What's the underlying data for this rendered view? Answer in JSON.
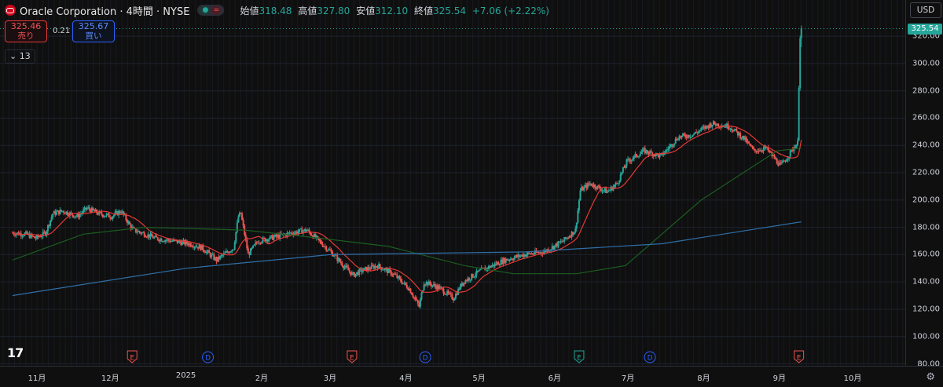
{
  "legend": {
    "symbol": "Oracle Corporation · 4時間 · NYSE",
    "ohlc": [
      {
        "label": "始値",
        "value": "318.48"
      },
      {
        "label": "高値",
        "value": "327.80"
      },
      {
        "label": "安値",
        "value": "312.10"
      },
      {
        "label": "終値",
        "value": "325.54"
      }
    ],
    "change": "+7.06 (+2.22%)"
  },
  "trade": {
    "sell_price": "325.46",
    "sell_label": "売り",
    "buy_price": "325.67",
    "buy_label": "買い",
    "spread": "0.21"
  },
  "indicator_toggle": "13",
  "currency": "USD",
  "last_price": "325.54",
  "colors": {
    "up": "#26a69a",
    "down": "#ef5350",
    "ma_fast": "#e53935",
    "ma_mid": "#1b5e20",
    "ma_slow": "#2f6fa8",
    "grid": "#1e222d"
  },
  "chart_data": {
    "type": "candlestick",
    "title": "",
    "xlabel": "",
    "ylabel": "",
    "ylim": [
      80,
      340
    ],
    "y_ticks": [
      "320.00",
      "300.00",
      "280.00",
      "260.00",
      "240.00",
      "220.00",
      "200.00",
      "180.00",
      "160.00",
      "140.00",
      "120.00",
      "100.00",
      "80.00"
    ],
    "x_ticks": [
      "11月",
      "12月",
      "2025",
      "2月",
      "3月",
      "4月",
      "5月",
      "6月",
      "7月",
      "8月",
      "9月",
      "10月"
    ],
    "price_path": [
      [
        "2024-10-22",
        176
      ],
      [
        "2024-10-28",
        175
      ],
      [
        "2024-11-01",
        172
      ],
      [
        "2024-11-05",
        176
      ],
      [
        "2024-11-08",
        190
      ],
      [
        "2024-11-12",
        192
      ],
      [
        "2024-11-18",
        188
      ],
      [
        "2024-11-22",
        194
      ],
      [
        "2024-11-27",
        190
      ],
      [
        "2024-12-02",
        188
      ],
      [
        "2024-12-06",
        192
      ],
      [
        "2024-12-09",
        183
      ],
      [
        "2024-12-11",
        178
      ],
      [
        "2024-12-16",
        175
      ],
      [
        "2024-12-20",
        172
      ],
      [
        "2024-12-27",
        170
      ],
      [
        "2025-01-03",
        168
      ],
      [
        "2025-01-08",
        165
      ],
      [
        "2025-01-14",
        156
      ],
      [
        "2025-01-17",
        160
      ],
      [
        "2025-01-21",
        165
      ],
      [
        "2025-01-23",
        188
      ],
      [
        "2025-01-24",
        190
      ],
      [
        "2025-01-27",
        160
      ],
      [
        "2025-01-31",
        170
      ],
      [
        "2025-02-07",
        173
      ],
      [
        "2025-02-14",
        176
      ],
      [
        "2025-02-20",
        178
      ],
      [
        "2025-02-25",
        170
      ],
      [
        "2025-03-03",
        160
      ],
      [
        "2025-03-07",
        152
      ],
      [
        "2025-03-11",
        145
      ],
      [
        "2025-03-14",
        148
      ],
      [
        "2025-03-21",
        152
      ],
      [
        "2025-03-28",
        145
      ],
      [
        "2025-04-03",
        135
      ],
      [
        "2025-04-07",
        122
      ],
      [
        "2025-04-09",
        140
      ],
      [
        "2025-04-15",
        136
      ],
      [
        "2025-04-21",
        128
      ],
      [
        "2025-04-25",
        140
      ],
      [
        "2025-05-02",
        148
      ],
      [
        "2025-05-12",
        156
      ],
      [
        "2025-05-20",
        160
      ],
      [
        "2025-05-28",
        162
      ],
      [
        "2025-06-05",
        170
      ],
      [
        "2025-06-10",
        178
      ],
      [
        "2025-06-12",
        207
      ],
      [
        "2025-06-16",
        212
      ],
      [
        "2025-06-23",
        206
      ],
      [
        "2025-06-27",
        212
      ],
      [
        "2025-07-01",
        228
      ],
      [
        "2025-07-08",
        236
      ],
      [
        "2025-07-15",
        232
      ],
      [
        "2025-07-22",
        246
      ],
      [
        "2025-07-28",
        248
      ],
      [
        "2025-08-01",
        252
      ],
      [
        "2025-08-05",
        256
      ],
      [
        "2025-08-12",
        254
      ],
      [
        "2025-08-18",
        245
      ],
      [
        "2025-08-22",
        236
      ],
      [
        "2025-08-27",
        238
      ],
      [
        "2025-09-02",
        225
      ],
      [
        "2025-09-05",
        232
      ],
      [
        "2025-09-08",
        240
      ],
      [
        "2025-09-09",
        242
      ],
      [
        "2025-09-10",
        326
      ]
    ],
    "series": [
      {
        "values_from": "price_path",
        "style": "candles"
      },
      {
        "style": "ma_fast"
      },
      {
        "style": "ma_mid",
        "path": [
          [
            "2024-10-22",
            156
          ],
          [
            "2024-11-20",
            175
          ],
          [
            "2024-12-15",
            180
          ],
          [
            "2025-01-25",
            178
          ],
          [
            "2025-02-25",
            172
          ],
          [
            "2025-03-25",
            166
          ],
          [
            "2025-04-25",
            152
          ],
          [
            "2025-05-15",
            146
          ],
          [
            "2025-06-10",
            146
          ],
          [
            "2025-06-30",
            152
          ],
          [
            "2025-07-31",
            200
          ],
          [
            "2025-08-31",
            236
          ],
          [
            "2025-09-10",
            238
          ]
        ]
      },
      {
        "style": "ma_slow",
        "path": [
          [
            "2024-10-22",
            130
          ],
          [
            "2025-01-01",
            150
          ],
          [
            "2025-03-01",
            160
          ],
          [
            "2025-05-20",
            162
          ],
          [
            "2025-07-15",
            168
          ],
          [
            "2025-09-10",
            184
          ]
        ]
      }
    ],
    "events": [
      {
        "type": "E",
        "date": "2024-12-10",
        "color": "#ef5350"
      },
      {
        "type": "D",
        "date": "2025-01-10",
        "color": "#2962ff"
      },
      {
        "type": "E",
        "date": "2025-03-10",
        "color": "#ef5350"
      },
      {
        "type": "D",
        "date": "2025-04-09",
        "color": "#2962ff"
      },
      {
        "type": "E",
        "date": "2025-06-11",
        "color": "#26a69a"
      },
      {
        "type": "D",
        "date": "2025-07-10",
        "color": "#2962ff"
      },
      {
        "type": "E",
        "date": "2025-09-09",
        "color": "#ef5350"
      }
    ],
    "grid": true
  }
}
